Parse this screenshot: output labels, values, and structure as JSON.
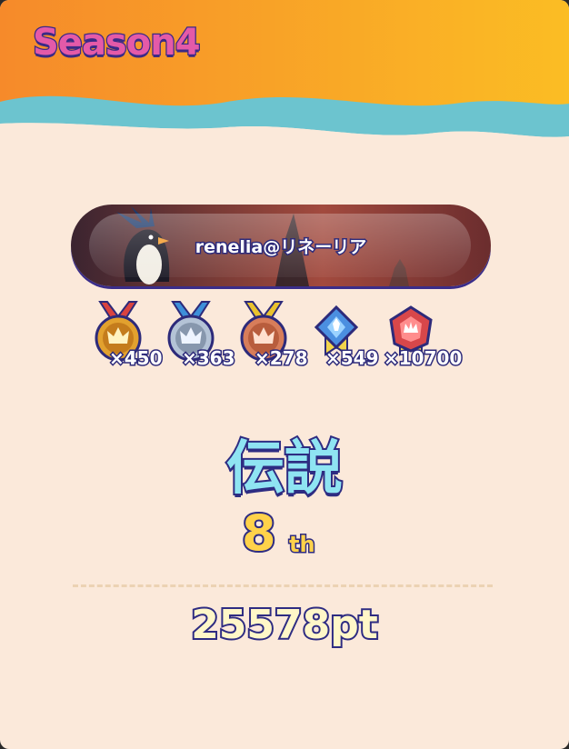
{
  "season": {
    "title": "Season4"
  },
  "player": {
    "name": "renelia@リネーリア"
  },
  "medals": [
    {
      "icon": "gold-crown-medal-icon",
      "count": "×450",
      "color": "#e2a12e"
    },
    {
      "icon": "silver-crown-medal-icon",
      "count": "×363",
      "color": "#9fb0c8"
    },
    {
      "icon": "bronze-crown-medal-icon",
      "count": "×278",
      "color": "#d77d5a"
    },
    {
      "icon": "blue-gem-badge-icon",
      "count": "×549",
      "color": "#4b8fe0"
    },
    {
      "icon": "red-gem-badge-icon",
      "count": "×10700",
      "color": "#d8474a"
    }
  ],
  "rank": {
    "title": "伝説",
    "position": "8",
    "suffix": "th"
  },
  "score": {
    "points": "25578pt"
  }
}
